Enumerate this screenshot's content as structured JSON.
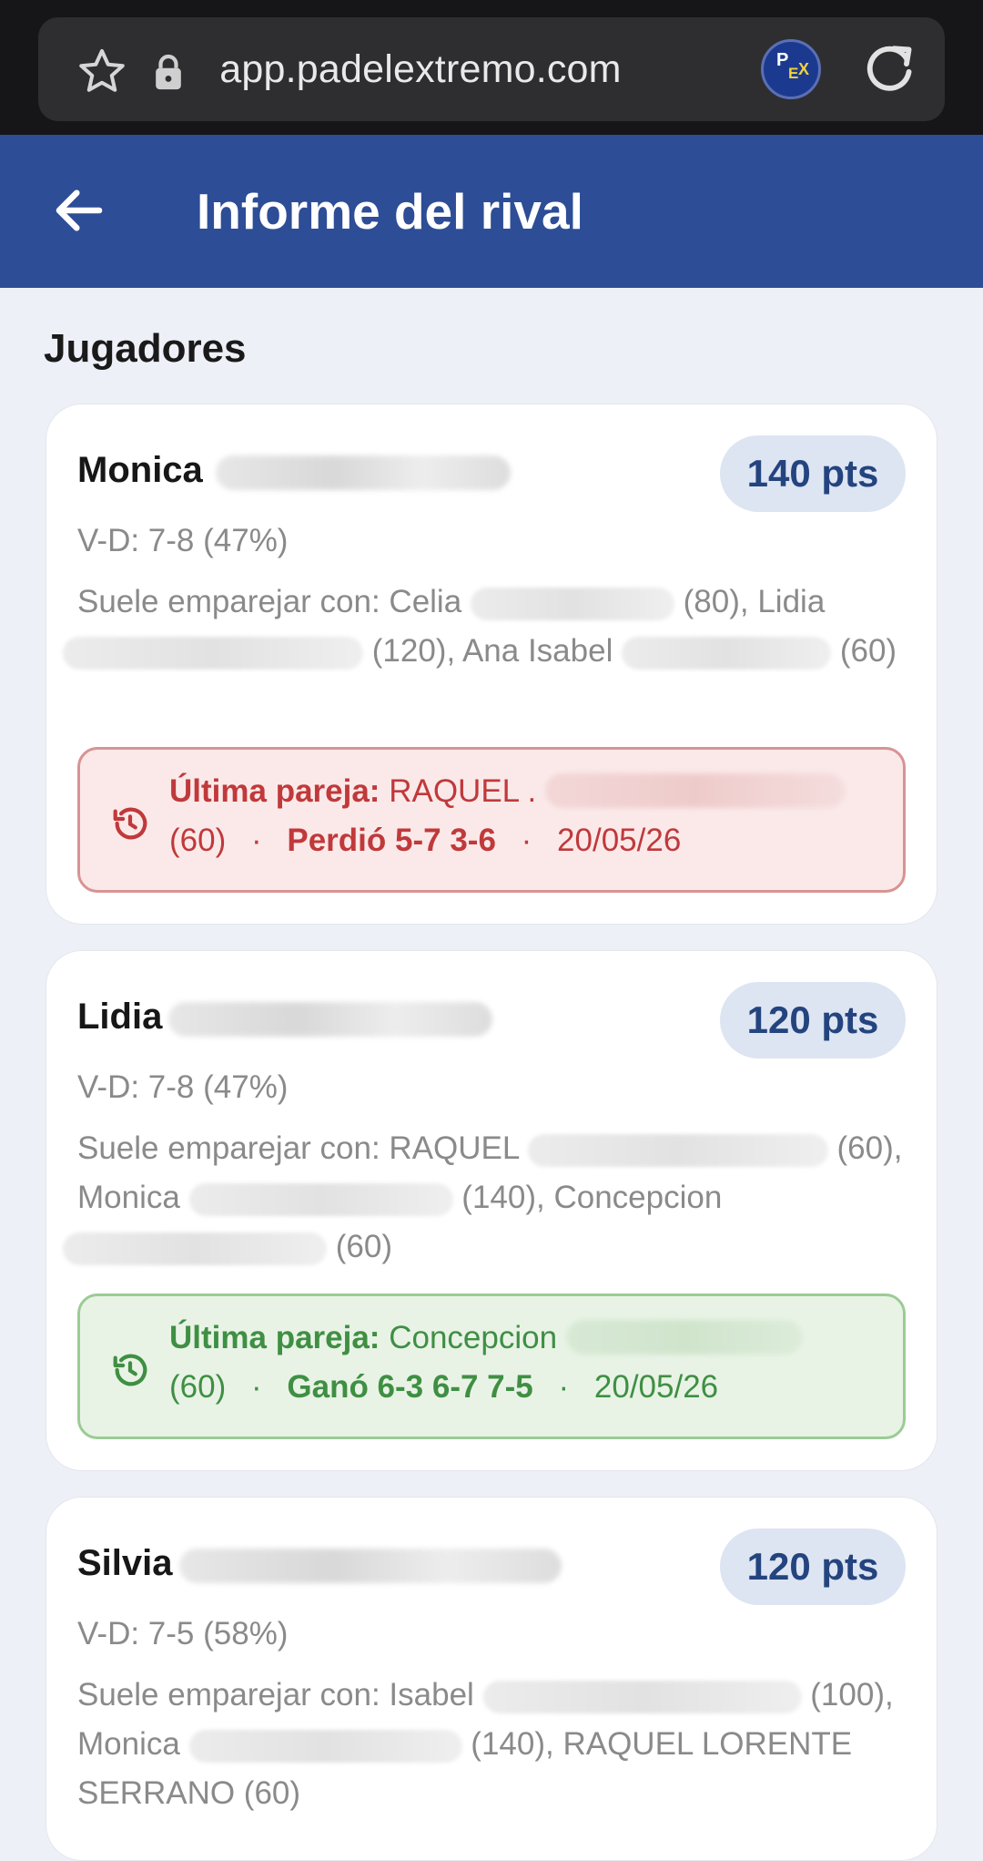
{
  "browser": {
    "url": "app.padelextremo.com",
    "star_icon": "star-icon",
    "lock_icon": "lock-icon",
    "site_logo_text": "PEX",
    "reload_icon": "reload-icon"
  },
  "app_bar": {
    "title": "Informe del rival",
    "back_icon": "arrow-back-icon",
    "color": "#2d4d96"
  },
  "section": {
    "title": "Jugadores"
  },
  "players": [
    {
      "name": "Monica",
      "points": "140 pts",
      "record": "V-D: 7-8 (47%)",
      "partners_prefix": "Suele emparejar con: Celia",
      "partners_p1": "(80), Lidia",
      "partners_p2": "(120), Ana Isabel",
      "partners_p3": "(60)",
      "last_label": "Última pareja:",
      "last_partner": "RAQUEL .",
      "last_partner_pts": "(60)",
      "last_result": "Perdió 5-7 3-6",
      "last_date": "20/05/26",
      "outcome": "loss"
    },
    {
      "name": "Lidia",
      "points": "120 pts",
      "record": "V-D: 7-8 (47%)",
      "partners_prefix": "Suele emparejar con: RAQUEL",
      "partners_p1": "(60), Monica",
      "partners_p2": "(140), Concepcion",
      "partners_p3": "(60)",
      "last_label": "Última pareja:",
      "last_partner": "Concepcion",
      "last_partner_pts": "(60)",
      "last_result": "Ganó 6-3 6-7 7-5",
      "last_date": "20/05/26",
      "outcome": "win"
    },
    {
      "name": "Silvia",
      "points": "120 pts",
      "record": "V-D: 7-5 (58%)",
      "partners_prefix": "Suele emparejar con: Isabel",
      "partners_p1": "(100), Monica",
      "partners_p2": "(140), RAQUEL",
      "partners_p3": "LORENTE SERRANO (60)"
    }
  ],
  "separator": "·"
}
